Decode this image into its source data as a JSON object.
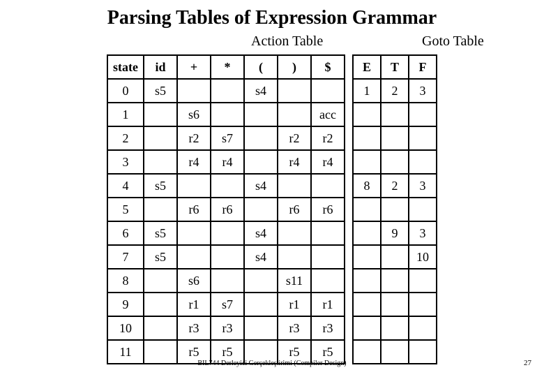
{
  "title": "Parsing Tables of Expression Grammar",
  "section_labels": {
    "action": "Action Table",
    "goto": "Goto Table"
  },
  "headers": {
    "state": "state",
    "action": [
      "id",
      "+",
      "*",
      "(",
      ")",
      "$"
    ],
    "goto": [
      "E",
      "T",
      "F"
    ]
  },
  "rows": [
    {
      "state": "0",
      "action": [
        "s5",
        "",
        "",
        "s4",
        "",
        ""
      ],
      "goto": [
        "1",
        "2",
        "3"
      ]
    },
    {
      "state": "1",
      "action": [
        "",
        "s6",
        "",
        "",
        "",
        "acc"
      ],
      "goto": [
        "",
        "",
        ""
      ]
    },
    {
      "state": "2",
      "action": [
        "",
        "r2",
        "s7",
        "",
        "r2",
        "r2"
      ],
      "goto": [
        "",
        "",
        ""
      ]
    },
    {
      "state": "3",
      "action": [
        "",
        "r4",
        "r4",
        "",
        "r4",
        "r4"
      ],
      "goto": [
        "",
        "",
        ""
      ]
    },
    {
      "state": "4",
      "action": [
        "s5",
        "",
        "",
        "s4",
        "",
        ""
      ],
      "goto": [
        "8",
        "2",
        "3"
      ]
    },
    {
      "state": "5",
      "action": [
        "",
        "r6",
        "r6",
        "",
        "r6",
        "r6"
      ],
      "goto": [
        "",
        "",
        ""
      ]
    },
    {
      "state": "6",
      "action": [
        "s5",
        "",
        "",
        "s4",
        "",
        ""
      ],
      "goto": [
        "",
        "9",
        "3"
      ]
    },
    {
      "state": "7",
      "action": [
        "s5",
        "",
        "",
        "s4",
        "",
        ""
      ],
      "goto": [
        "",
        "",
        "10"
      ]
    },
    {
      "state": "8",
      "action": [
        "",
        "s6",
        "",
        "",
        "s11",
        ""
      ],
      "goto": [
        "",
        "",
        ""
      ]
    },
    {
      "state": "9",
      "action": [
        "",
        "r1",
        "s7",
        "",
        "r1",
        "r1"
      ],
      "goto": [
        "",
        "",
        ""
      ]
    },
    {
      "state": "10",
      "action": [
        "",
        "r3",
        "r3",
        "",
        "r3",
        "r3"
      ],
      "goto": [
        "",
        "",
        ""
      ]
    },
    {
      "state": "11",
      "action": [
        "",
        "r5",
        "r5",
        "",
        "r5",
        "r5"
      ],
      "goto": [
        "",
        "",
        ""
      ]
    }
  ],
  "footer": "BIL744 Derleyici Gerçekleştirimi (Compiler Design)",
  "page_number": "27"
}
